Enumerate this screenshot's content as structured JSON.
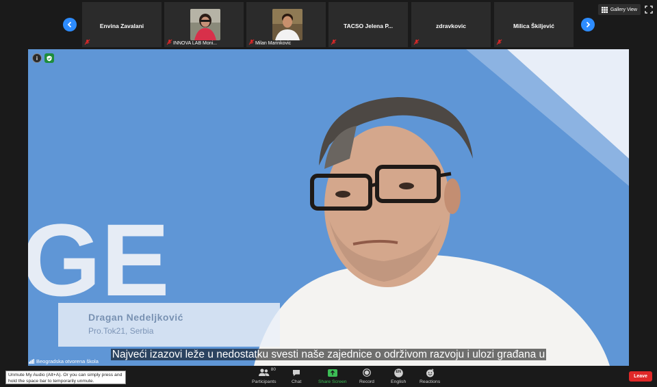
{
  "participants_strip": {
    "tiles": [
      {
        "name": "Envina Zavalani",
        "label": ""
      },
      {
        "name": "",
        "label": "INNOVA LAB Moni..."
      },
      {
        "name": "",
        "label": "Milan Marinkovic"
      },
      {
        "name": "TACSO Jelena P...",
        "label": ""
      },
      {
        "name": "zdravkovic",
        "label": ""
      },
      {
        "name": "Milica Škiljević",
        "label": ""
      }
    ]
  },
  "view": {
    "gallery_label": "Gallery View"
  },
  "video": {
    "lower_third_name": "Dragan Nedeljković",
    "lower_third_org": "Pro.Tok21, Serbia",
    "subtitle": "Najveći izazovi leže u nedostatku svesti naše zajednice o održivom razvoju i ulozi građana u",
    "background_letters": "GE"
  },
  "active_speaker": "Beogradska otvorena škola",
  "tooltip": "Unmute My Audio (Alt+A). Or you can simply press and hold the space bar to temporarily unmute.",
  "toolbar": {
    "participants_label": "Participants",
    "participants_count": "80",
    "chat_label": "Chat",
    "share_label": "Share Screen",
    "record_label": "Record",
    "language_label": "English",
    "language_badge": "EN",
    "reactions_label": "Reactions",
    "leave_label": "Leave"
  },
  "colors": {
    "accent": "#2d8cff",
    "share_green": "#3cbd55",
    "leave_red": "#e02828",
    "video_bg": "#5f96d6"
  }
}
